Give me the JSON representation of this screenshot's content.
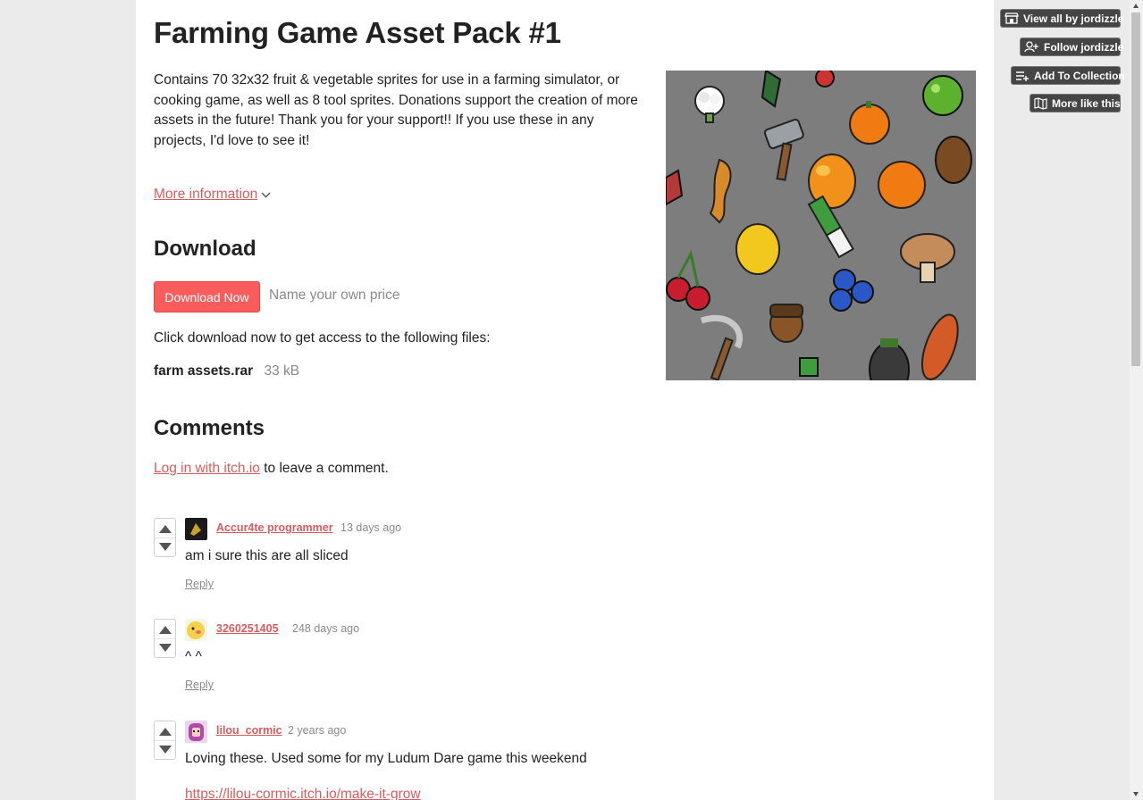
{
  "game": {
    "title": "Farming Game Asset Pack #1",
    "description": "Contains 70 32x32 fruit & vegetable sprites for use in a farming simulator, or cooking game, as well as 8 tool sprites. Donations support the creation of more assets in the future! Thank you for your support!! If you use these in any projects, I'd love to see it!",
    "more_info_label": "More information",
    "screenshot_icon": "fruit-vegetable-sprites-screenshot"
  },
  "download": {
    "heading": "Download",
    "button_label": "Download Now",
    "price_note": "Name your own price",
    "files_intro": "Click download now to get access to the following files:",
    "files": [
      {
        "name": "farm assets.rar",
        "size": "33 kB"
      }
    ]
  },
  "comments_section": {
    "heading": "Comments",
    "login_link": "Log in with itch.io",
    "login_suffix": " to leave a comment.",
    "reply_label": "Reply",
    "comments": [
      {
        "author": "Accur4te programmer",
        "time": "13 days ago",
        "body": "am i sure this are all sliced",
        "avatar_icon": "dark-avatar-icon"
      },
      {
        "author": "3260251405",
        "time": "248 days ago",
        "body": "^ ^",
        "avatar_icon": "yellow-face-avatar-icon"
      },
      {
        "author": "lilou_cormic",
        "time": "2 years ago",
        "body": "Loving these. Used some for my Ludum Dare game this weekend",
        "link": "https://lilou-cormic.itch.io/make-it-grow",
        "avatar_icon": "pink-hair-avatar-icon"
      }
    ]
  },
  "sidebar": {
    "view_all": "View all by jordizzle",
    "follow": "Follow jordizzle",
    "add_collection": "Add To Collection",
    "more_like": "More like this"
  },
  "colors": {
    "accent": "#fa5c5c",
    "link": "#da5b5e",
    "page_bg": "#ebebeb",
    "side_button_bg": "#454545"
  }
}
